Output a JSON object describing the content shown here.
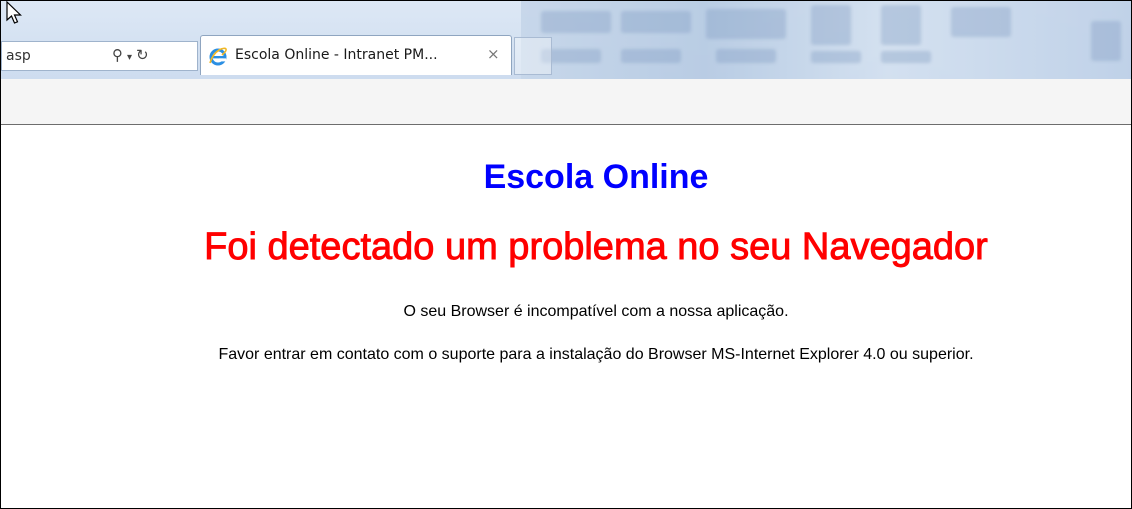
{
  "browser": {
    "address_fragment": "asp",
    "search_icon": "search-icon",
    "dropdown_icon": "chevron-down-icon",
    "refresh_icon": "refresh-icon",
    "tab": {
      "title": "Escola Online - Intranet PM...",
      "icon": "ie-logo-icon",
      "close_glyph": "×"
    }
  },
  "page": {
    "site_title": "Escola Online",
    "error_title": "Foi detectado um problema no seu Navegador",
    "message_line_1": "O seu Browser é incompatível com a nossa aplicação.",
    "message_line_2": "Favor entrar em contato com o suporte para a instalação do Browser MS-Internet Explorer 4.0 ou superior."
  },
  "colors": {
    "site_title": "#0000ff",
    "error_title": "#ff0000",
    "text": "#000000"
  }
}
